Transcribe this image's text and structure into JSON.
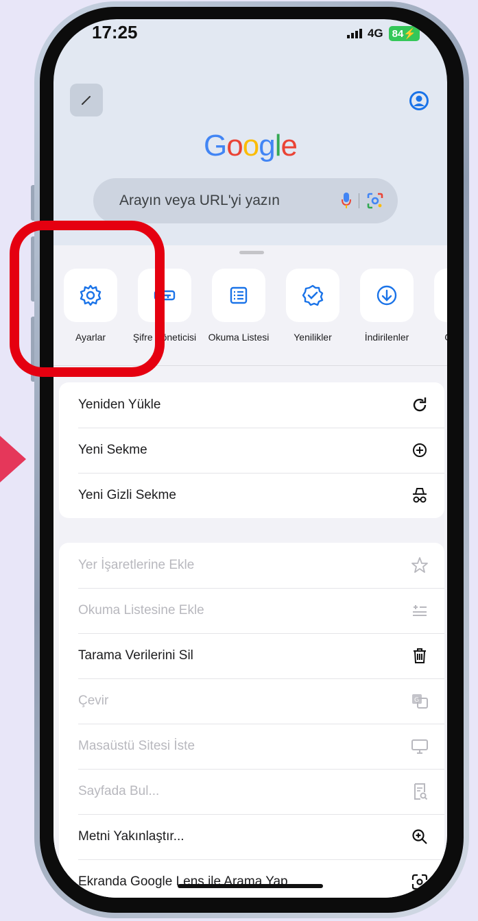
{
  "status_bar": {
    "time": "17:25",
    "network": "4G",
    "battery": "84"
  },
  "google_logo": {
    "letters": [
      "G",
      "o",
      "o",
      "g",
      "l",
      "e"
    ],
    "colors": [
      "#4285F4",
      "#EA4335",
      "#FBBC05",
      "#4285F4",
      "#34A853",
      "#EA4335"
    ]
  },
  "search": {
    "placeholder": "Arayın veya URL'yi yazın"
  },
  "toolbar": {
    "items": [
      {
        "label": "Ayarlar",
        "icon": "gear-icon"
      },
      {
        "label": "Şifre Yöneticisi",
        "icon": "key-icon"
      },
      {
        "label": "Okuma Listesi",
        "icon": "reading-list-icon"
      },
      {
        "label": "Yenilikler",
        "icon": "verified-badge-icon"
      },
      {
        "label": "İndirilenler",
        "icon": "download-icon"
      },
      {
        "label": "Geçmiş",
        "icon": "history-icon"
      }
    ]
  },
  "menu_group_1": [
    {
      "label": "Yeniden Yükle",
      "icon": "reload-icon",
      "enabled": true
    },
    {
      "label": "Yeni Sekme",
      "icon": "new-tab-icon",
      "enabled": true
    },
    {
      "label": "Yeni Gizli Sekme",
      "icon": "incognito-icon",
      "enabled": true
    }
  ],
  "menu_group_2": [
    {
      "label": "Yer İşaretlerine Ekle",
      "icon": "star-icon",
      "enabled": false
    },
    {
      "label": "Okuma Listesine Ekle",
      "icon": "add-reading-list-icon",
      "enabled": false
    },
    {
      "label": "Tarama Verilerini Sil",
      "icon": "trash-icon",
      "enabled": true
    },
    {
      "label": "Çevir",
      "icon": "translate-icon",
      "enabled": false
    },
    {
      "label": "Masaüstü Sitesi İste",
      "icon": "desktop-icon",
      "enabled": false
    },
    {
      "label": "Sayfada Bul...",
      "icon": "find-in-page-icon",
      "enabled": false
    },
    {
      "label": "Metni Yakınlaştır...",
      "icon": "zoom-text-icon",
      "enabled": true
    },
    {
      "label": "Ekranda Google Lens ile Arama Yap",
      "icon": "lens-icon",
      "enabled": true
    }
  ],
  "colors": {
    "accent_blue": "#1a73e8",
    "highlight_red": "#e50010",
    "pointer_pink": "#e5375a"
  }
}
